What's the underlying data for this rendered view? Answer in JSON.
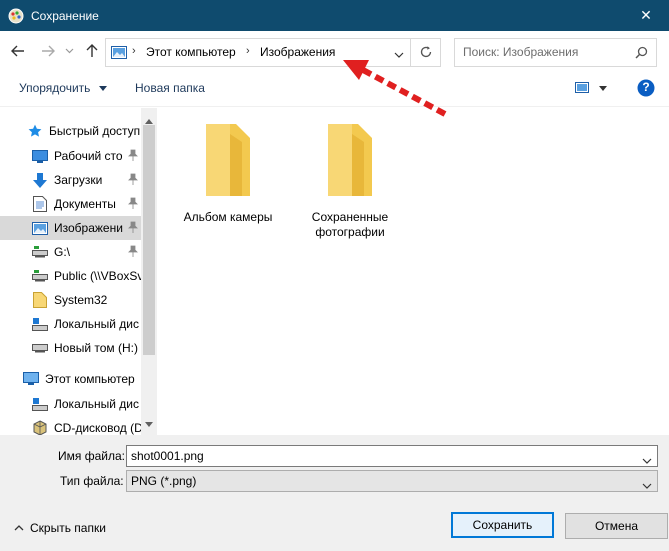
{
  "window": {
    "title": "Сохранение",
    "close_glyph": "✕"
  },
  "address": {
    "segments": [
      "Этот компьютер",
      "Изображения"
    ],
    "separator": "›"
  },
  "search": {
    "placeholder": "Поиск: Изображения"
  },
  "toolbar": {
    "organize_label": "Упорядочить",
    "new_folder_label": "Новая папка",
    "help_glyph": "?"
  },
  "nav": {
    "quick_access": "Быстрый доступ",
    "items": [
      {
        "label": "Рабочий сто",
        "icon": "desktop-icon",
        "pinned": true
      },
      {
        "label": "Загрузки",
        "icon": "downloads-icon",
        "pinned": true
      },
      {
        "label": "Документы",
        "icon": "documents-icon",
        "pinned": true
      },
      {
        "label": "Изображени",
        "icon": "pictures-icon",
        "pinned": true,
        "selected": true
      },
      {
        "label": "G:\\",
        "icon": "network-drive-icon",
        "pinned": true
      },
      {
        "label": "Public (\\\\VBoxSv",
        "icon": "network-share-icon",
        "pinned": false
      },
      {
        "label": "System32",
        "icon": "folder-icon",
        "pinned": false
      },
      {
        "label": "Локальный дис",
        "icon": "local-disk-icon",
        "pinned": false
      },
      {
        "label": "Новый том (H:)",
        "icon": "drive-icon",
        "pinned": false
      }
    ],
    "this_pc": "Этот компьютер",
    "pc_items": [
      {
        "label": "Локальный дис",
        "icon": "local-disk-icon"
      },
      {
        "label": "CD-дисковод (D",
        "icon": "cd-drive-icon"
      }
    ]
  },
  "content": {
    "folders": [
      {
        "name": "Альбом камеры"
      },
      {
        "name": "Сохраненные фотографии"
      }
    ]
  },
  "form": {
    "filename_label": "Имя файла:",
    "filename_value": "shot0001.png",
    "filetype_label": "Тип файла:",
    "filetype_value": "PNG (*.png)"
  },
  "footer": {
    "hide_folders_label": "Скрыть папки",
    "save_label": "Сохранить",
    "cancel_label": "Отмена"
  },
  "colors": {
    "titlebar": "#0f4b6e",
    "accent": "#0078d7",
    "folder": "#f8d775",
    "annotation": "#e02020"
  }
}
